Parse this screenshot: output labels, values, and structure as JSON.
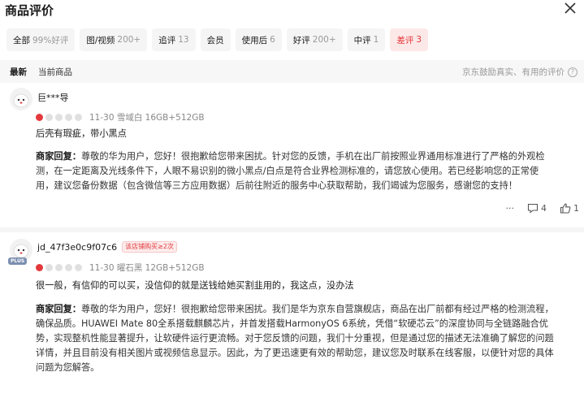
{
  "header": {
    "title": "商品评价"
  },
  "filters": [
    {
      "label": "全部",
      "count": "99%好评",
      "active": false
    },
    {
      "label": "图/视频",
      "count": "200+",
      "active": false
    },
    {
      "label": "追评",
      "count": "13",
      "active": false
    },
    {
      "label": "会员",
      "count": "",
      "active": false
    },
    {
      "label": "使用后",
      "count": "6",
      "active": false
    },
    {
      "label": "好评",
      "count": "200+",
      "active": false
    },
    {
      "label": "中评",
      "count": "1",
      "active": false
    },
    {
      "label": "差评",
      "count": "3",
      "active": true
    }
  ],
  "sort": {
    "options": [
      "最新",
      "当前商品"
    ],
    "note": "京东鼓励真实、有用的评价"
  },
  "colors": {
    "accent": "#e4393c",
    "chip_bg": "#f5f5f5"
  },
  "reviews": [
    {
      "user": "巨***导",
      "badge": "",
      "rating": 1,
      "meta": "11-30  雪域白 16GB+512GB",
      "content": "后壳有瑕疵，带小黑点",
      "reply_label": "商家回复：",
      "reply": "尊敬的华为用户，您好！很抱歉给您带来困扰。针对您的反馈，手机在出厂前按照业界通用标准进行了严格的外观检测，在一定距离及光线条件下，人眼不易识别的微小黑点/白点是符合业界检测标准的，请您放心使用。若已经影响您的正常使用，建议您备份数据（包含微信等三方应用数据）后前往附近的服务中心获取帮助，我们竭诚为您服务，感谢您的支持！",
      "comments": "4",
      "likes": "1"
    },
    {
      "user": "jd_47f3e0c9f07c6",
      "badge": "该店铺购买≥2次",
      "plus": "PLUS",
      "rating": 1,
      "meta": "11-30  曜石黑 12GB+512GB",
      "content": "很一般，有信仰的可以买，没信仰的就是送钱给她买割韭用的，我这点，没办法",
      "reply_label": "商家回复：",
      "reply": "尊敬的华为用户，您好！很抱歉给您带来困扰。我们是华为京东自营旗舰店，商品在出厂前都有经过严格的检测流程，确保品质。HUAWEI Mate 80全系搭载麒麟芯片，并首发搭载HarmonyOS 6系统，凭借“软硬芯云”的深度协同与全链路融合优势，实现整机性能显著提升，让软硬件运行更流畅。对于您反馈的问题，我们十分重视，但是通过您的描述无法准确了解您的问题详情，并且目前没有相关图片或视频信息显示。因此，为了更迅速更有效的帮助您，建议您及时联系在线客服，以便针对您的具体问题为您解答。"
    }
  ]
}
